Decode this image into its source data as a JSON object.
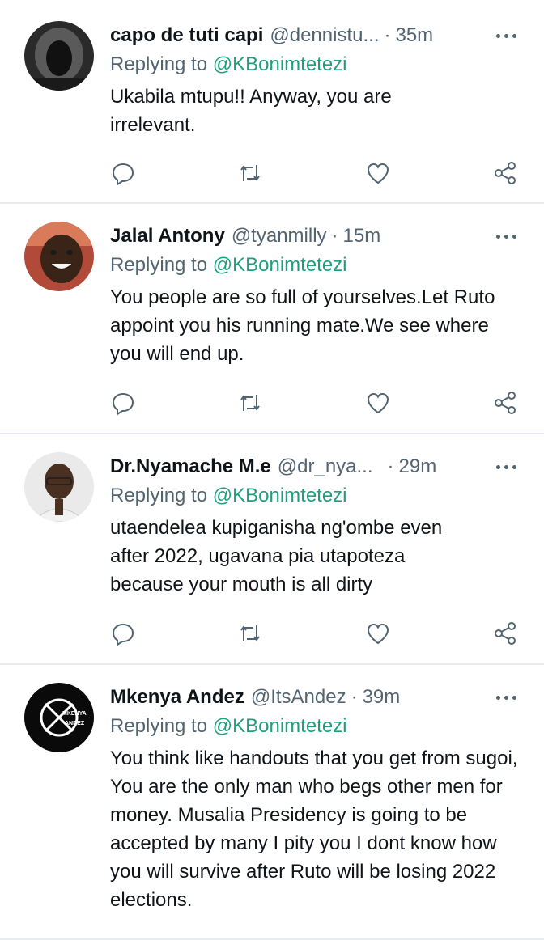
{
  "tweets": [
    {
      "name": "capo de tuti capi",
      "handle": "@dennistu...",
      "time": "35m",
      "replying_prefix": "Replying to",
      "replying_to": "@KBonimtetezi",
      "text": "Ukabila mtupu!! Anyway, you are irrelevant."
    },
    {
      "name": "Jalal Antony",
      "handle": "@tyanmilly",
      "time": "15m",
      "replying_prefix": "Replying to",
      "replying_to": "@KBonimtetezi",
      "text": "You people are so full of yourselves.Let Ruto appoint you his running mate.We see where you will end up."
    },
    {
      "name": "Dr.Nyamache M.e",
      "handle": "@dr_nya...",
      "time": "29m",
      "replying_prefix": "Replying to",
      "replying_to": "@KBonimtetezi",
      "text": "utaendelea kupiganisha ng'ombe even after 2022, ugavana pia utapoteza because your mouth is all dirty"
    },
    {
      "name": "Mkenya Andez",
      "handle": "@ItsAndez",
      "time": "39m",
      "replying_prefix": "Replying to",
      "replying_to": "@KBonimtetezi",
      "text": "You think like handouts that you get from sugoi, You are the only man who begs other men for money. Musalia Presidency is going to be accepted by many I pity you I dont know how you will survive after Ruto will be losing 2022 elections.",
      "avatar_logo_text": "MKENYA ANDEZ"
    }
  ],
  "separator": "·",
  "icons": [
    "reply-icon",
    "retweet-icon",
    "like-icon",
    "share-icon",
    "more-icon"
  ],
  "colors": {
    "mention": "#1da07c",
    "secondary": "#536471",
    "primary": "#0f1419",
    "divider": "#e6ecf0"
  }
}
